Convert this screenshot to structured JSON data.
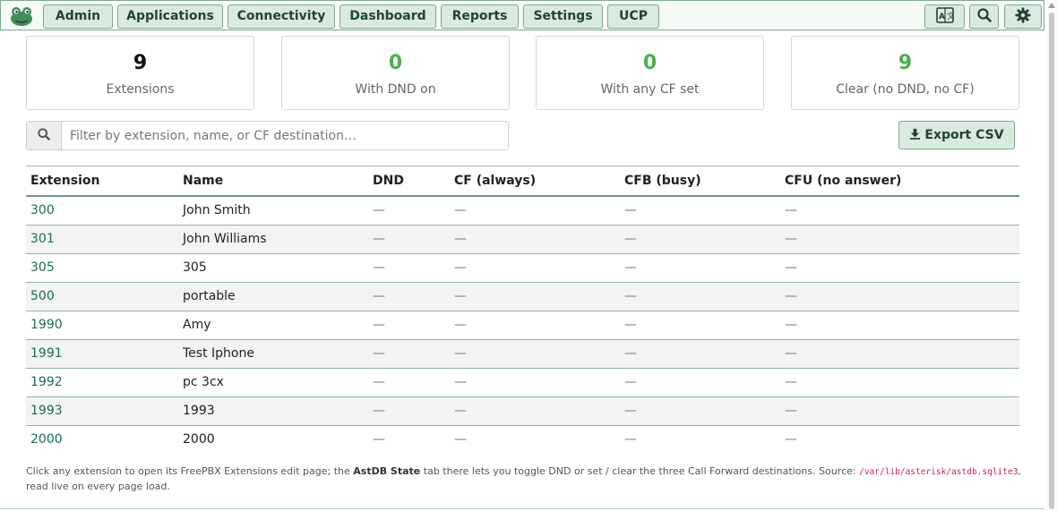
{
  "nav": {
    "items": [
      "Admin",
      "Applications",
      "Connectivity",
      "Dashboard",
      "Reports",
      "Settings",
      "UCP"
    ],
    "icons": [
      "language-icon",
      "search-icon",
      "gear-icon"
    ]
  },
  "stats": [
    {
      "value": "9",
      "label": "Extensions",
      "color": "#111111"
    },
    {
      "value": "0",
      "label": "With DND on",
      "color": "#4caf50"
    },
    {
      "value": "0",
      "label": "With any CF set",
      "color": "#4caf50"
    },
    {
      "value": "9",
      "label": "Clear (no DND, no CF)",
      "color": "#4caf50"
    }
  ],
  "filter": {
    "placeholder": "Filter by extension, name, or CF destination…",
    "value": ""
  },
  "export_label": "Export CSV",
  "table": {
    "headers": [
      "Extension",
      "Name",
      "DND",
      "CF (always)",
      "CFB (busy)",
      "CFU (no answer)"
    ],
    "rows": [
      [
        "300",
        "John Smith",
        "—",
        "—",
        "—",
        "—"
      ],
      [
        "301",
        "John Williams",
        "—",
        "—",
        "—",
        "—"
      ],
      [
        "305",
        "305",
        "—",
        "—",
        "—",
        "—"
      ],
      [
        "500",
        "portable",
        "—",
        "—",
        "—",
        "—"
      ],
      [
        "1990",
        "Amy",
        "—",
        "—",
        "—",
        "—"
      ],
      [
        "1991",
        "Test Iphone",
        "—",
        "—",
        "—",
        "—"
      ],
      [
        "1992",
        "pc 3cx",
        "—",
        "—",
        "—",
        "—"
      ],
      [
        "1993",
        "1993",
        "—",
        "—",
        "—",
        "—"
      ],
      [
        "2000",
        "2000",
        "—",
        "—",
        "—",
        "—"
      ]
    ]
  },
  "footnote": {
    "part1": "Click any extension to open its FreePBX Extensions edit page; the ",
    "bold": "AstDB State",
    "part2": " tab there lets you toggle DND or set / clear the three Call Forward destinations. Source: ",
    "code": "/var/lib/asterisk/astdb.sqlite3",
    "part3": ", read live on every page load."
  },
  "colors": {
    "accent": "#1f4530",
    "button_bg": "#d9eadf",
    "link": "#1b6b58",
    "ok": "#4caf50"
  }
}
